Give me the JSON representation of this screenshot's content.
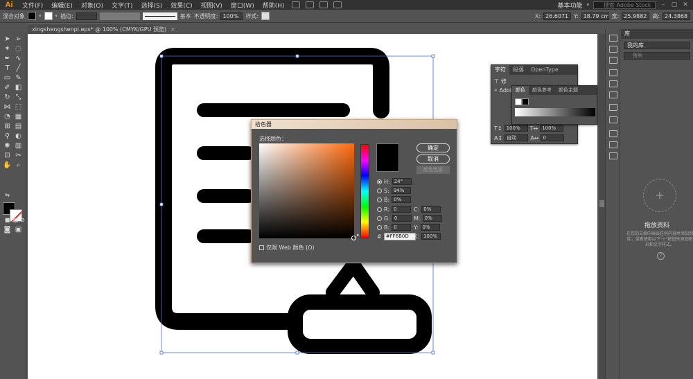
{
  "menubar": {
    "logo": "Ai",
    "items": [
      "文件(F)",
      "编辑(E)",
      "对象(O)",
      "文字(T)",
      "选择(S)",
      "效果(C)",
      "视图(V)",
      "窗口(W)",
      "帮助(H)"
    ],
    "workspace": "基本功能",
    "search_placeholder": "搜索 Adobe Stock"
  },
  "control_bar": {
    "selection_label": "混合对象",
    "stroke_label": "描边:",
    "stroke_style": "基本",
    "opacity_label": "不透明度:",
    "opacity_value": "100%",
    "style_label": "样式:",
    "x_label": "X:",
    "x_value": "26.6071",
    "y_label": "Y:",
    "y_value": "18.79 cm",
    "w_label": "宽:",
    "w_value": "25.9882",
    "h_label": "高:",
    "h_value": "24.3868"
  },
  "document": {
    "tab_title": "xingshengshenpi.eps* @ 100% (CMYK/GPU 预览)",
    "tab_close": "×"
  },
  "char_panel": {
    "tabs": [
      "字符",
      "段落",
      "OpenType"
    ],
    "font_family_prefix": "Adob",
    "row_label": "修",
    "scale_h": "100%",
    "scale_v": "100%",
    "leading": "自动",
    "tracking": "0"
  },
  "color_panel": {
    "tabs": [
      "颜色",
      "颜色参考",
      "颜色主题"
    ]
  },
  "color_picker": {
    "title": "拾色器",
    "prompt": "选择颜色：",
    "ok_label": "确定",
    "cancel_label": "取消",
    "library_label": "颜色色板",
    "fields": {
      "H": {
        "label": "H:",
        "value": "24°",
        "checked": true
      },
      "S": {
        "label": "S:",
        "value": "94%",
        "checked": false
      },
      "B": {
        "label": "B:",
        "value": "0%",
        "checked": false
      },
      "R": {
        "label": "R:",
        "value": "0",
        "checked": false
      },
      "G": {
        "label": "G:",
        "value": "0",
        "checked": false
      },
      "Bl": {
        "label": "B:",
        "value": "0",
        "checked": false
      }
    },
    "cmyk": {
      "C": {
        "label": "C:",
        "value": "0%"
      },
      "M": {
        "label": "M:",
        "value": "0%"
      },
      "Y": {
        "label": "Y:",
        "value": "0%"
      },
      "K": {
        "label": "K:",
        "value": "100%"
      }
    },
    "hex_label": "#",
    "hex_value": "#FF6B0D",
    "web_only_label": "仅限 Web 颜色 (O)",
    "preview_color": "#000000",
    "hue_color": "#ff6b0d"
  },
  "library_panel": {
    "tab_label": "库",
    "select_value": "我的库",
    "search_placeholder": "搜索",
    "drag_title": "拖放资料",
    "drag_desc": "在您的文档中画出任何内容并添加到库，或者使用以下\"+\"按钮来添加图形和文字样式。",
    "help_icon": "?"
  },
  "colors": {
    "accent": "#ff6b0d",
    "chrome_dark": "#323232",
    "chrome": "#535353",
    "art": "#000000"
  }
}
